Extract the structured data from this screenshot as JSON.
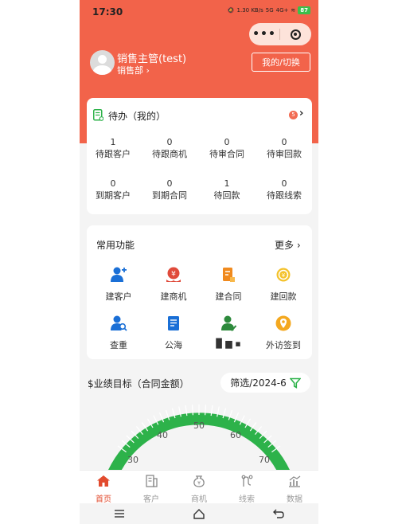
{
  "status_bar": {
    "time": "17:30",
    "speed": "1.30 KB/s",
    "network": "5G",
    "network2": "4G+",
    "battery": "87"
  },
  "capsule": {
    "more": "•••"
  },
  "user": {
    "name": "销售主管(test)",
    "dept": "销售部 ›",
    "switch_label": "我的/切换"
  },
  "todo": {
    "title": "待办（我的）",
    "badge": "5",
    "arrow": "›",
    "stats": [
      {
        "value": "1",
        "label": "待跟客户"
      },
      {
        "value": "0",
        "label": "待跟商机"
      },
      {
        "value": "0",
        "label": "待审合同"
      },
      {
        "value": "0",
        "label": "待审回款"
      },
      {
        "value": "0",
        "label": "到期客户"
      },
      {
        "value": "0",
        "label": "到期合同"
      },
      {
        "value": "1",
        "label": "待回款"
      },
      {
        "value": "0",
        "label": "待跟线索"
      }
    ]
  },
  "functions": {
    "title": "常用功能",
    "more": "更多 ›",
    "items": [
      {
        "label": "建客户",
        "icon": "add-user-icon"
      },
      {
        "label": "建商机",
        "icon": "opportunity-icon"
      },
      {
        "label": "建合同",
        "icon": "contract-icon"
      },
      {
        "label": "建回款",
        "icon": "payment-icon"
      },
      {
        "label": "查重",
        "icon": "duplicate-check-icon"
      },
      {
        "label": "公海",
        "icon": "public-pool-icon"
      },
      {
        "label": "▉ ▆ ▪",
        "icon": "user-check-icon"
      },
      {
        "label": "外访签到",
        "icon": "location-icon"
      }
    ]
  },
  "performance": {
    "title": "$业绩目标（合同金额）",
    "filter": "筛选/2024-6",
    "gauge_ticks": [
      "30",
      "40",
      "50",
      "60",
      "70"
    ]
  },
  "tabs": [
    {
      "label": "首页",
      "icon": "home-icon",
      "active": true
    },
    {
      "label": "客户",
      "icon": "customer-icon",
      "active": false
    },
    {
      "label": "商机",
      "icon": "opportunity-tab-icon",
      "active": false
    },
    {
      "label": "线索",
      "icon": "lead-icon",
      "active": false
    },
    {
      "label": "数据",
      "icon": "data-icon",
      "active": false
    }
  ],
  "colors": {
    "brand": "#f2634a",
    "gauge": "#2db24a",
    "active_tab": "#e24b2e",
    "icon_blue": "#1a6fd6"
  }
}
